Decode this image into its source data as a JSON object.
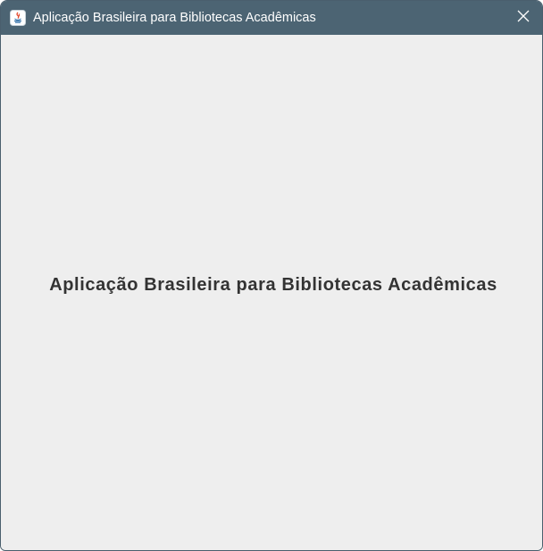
{
  "window": {
    "title": "Aplicação Brasileira para Bibliotecas Acadêmicas",
    "app_icon": "java-icon",
    "close_icon": "close-icon"
  },
  "main": {
    "heading": "Aplicação Brasileira para Bibliotecas Acadêmicas"
  },
  "colors": {
    "titlebar": "#4c6473",
    "background": "#eeeeee",
    "heading_text": "#333333"
  }
}
